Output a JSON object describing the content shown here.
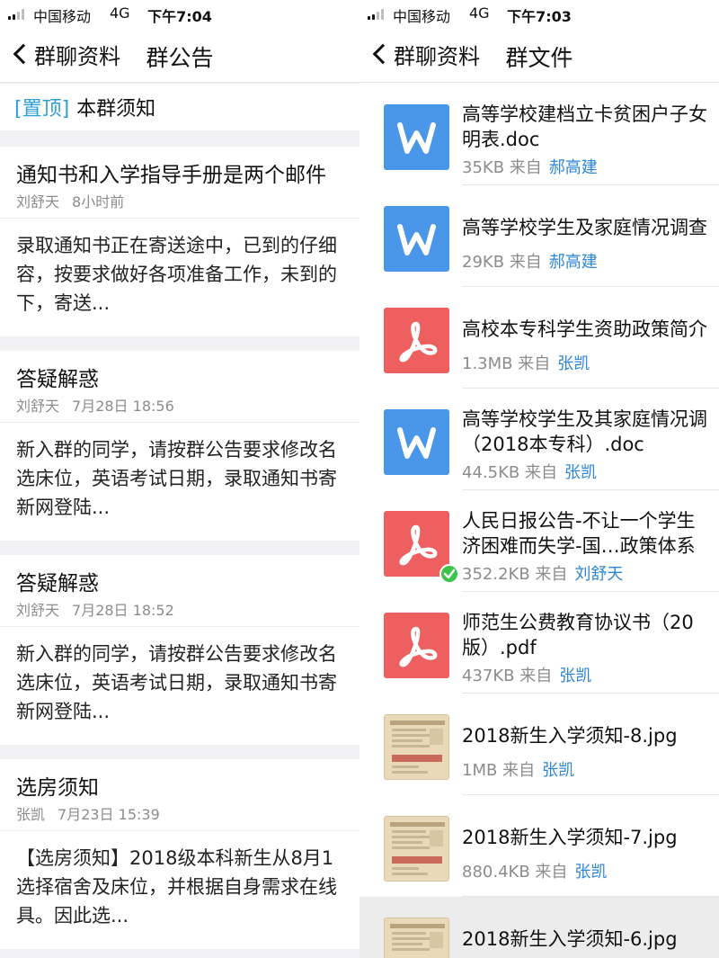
{
  "left": {
    "status": {
      "carrier": "中国移动",
      "network": "4G",
      "time": "下午7:04"
    },
    "nav": {
      "back_label": "群聊资料",
      "title": "群公告"
    },
    "pinned": {
      "tag": "[置顶]",
      "title": "本群须知"
    },
    "notices": [
      {
        "title": "通知书和入学指导手册是两个邮件",
        "author": "刘舒天",
        "time": "8小时前",
        "body": "录取通知书正在寄送途中，已到的仔细\n容，按要求做好各项准备工作，未到的\n下，寄送..."
      },
      {
        "title": "答疑解惑",
        "author": "刘舒天",
        "time": "7月28日 18:56",
        "body": "新入群的同学，请按群公告要求修改名\n选床位，英语考试日期，录取通知书寄\n新网登陆..."
      },
      {
        "title": "答疑解惑",
        "author": "刘舒天",
        "time": "7月28日 18:52",
        "body": "新入群的同学，请按群公告要求修改名\n选床位，英语考试日期，录取通知书寄\n新网登陆..."
      },
      {
        "title": "选房须知",
        "author": "张凯",
        "time": "7月23日 15:39",
        "body": "【选房须知】2018级本科新生从8月1\n选择宿舍及床位，并根据自身需求在线\n具。因此选..."
      }
    ]
  },
  "right": {
    "status": {
      "carrier": "中国移动",
      "network": "4G",
      "time": "下午7:03"
    },
    "nav": {
      "back_label": "群聊资料",
      "title": "群文件"
    },
    "from_label": "来自",
    "files": [
      {
        "type": "doc",
        "icon": "word-doc-icon",
        "name": "高等学校建档立卡贫困户子女\n明表.doc",
        "size": "35KB",
        "uploader": "郝高建",
        "downloaded": false
      },
      {
        "type": "doc",
        "icon": "word-doc-icon",
        "name": "高等学校学生及家庭情况调查",
        "size": "29KB",
        "uploader": "郝高建",
        "downloaded": false
      },
      {
        "type": "pdf",
        "icon": "pdf-icon",
        "name": "高校本专科学生资助政策简介",
        "size": "1.3MB",
        "uploader": "张凯",
        "downloaded": false
      },
      {
        "type": "doc",
        "icon": "word-doc-icon",
        "name": "高等学校学生及其家庭情况调\n（2018本专科）.doc",
        "size": "44.5KB",
        "uploader": "张凯",
        "downloaded": false
      },
      {
        "type": "pdf",
        "icon": "pdf-icon",
        "name": "人民日报公告-不让一个学生\n济困难而失学-国…政策体系",
        "size": "352.2KB",
        "uploader": "刘舒天",
        "downloaded": true
      },
      {
        "type": "pdf",
        "icon": "pdf-icon",
        "name": "师范生公费教育协议书（20\n版）.pdf",
        "size": "437KB",
        "uploader": "张凯",
        "downloaded": false
      },
      {
        "type": "img",
        "icon": "image-thumbnail-icon",
        "name": "2018新生入学须知-8.jpg",
        "size": "1MB",
        "uploader": "张凯",
        "downloaded": false
      },
      {
        "type": "img",
        "icon": "image-thumbnail-icon",
        "name": "2018新生入学须知-7.jpg",
        "size": "880.4KB",
        "uploader": "张凯",
        "downloaded": false
      },
      {
        "type": "img",
        "icon": "image-thumbnail-icon",
        "name": "2018新生入学须知-6.jpg",
        "size": "",
        "uploader": "",
        "downloaded": false
      }
    ]
  }
}
